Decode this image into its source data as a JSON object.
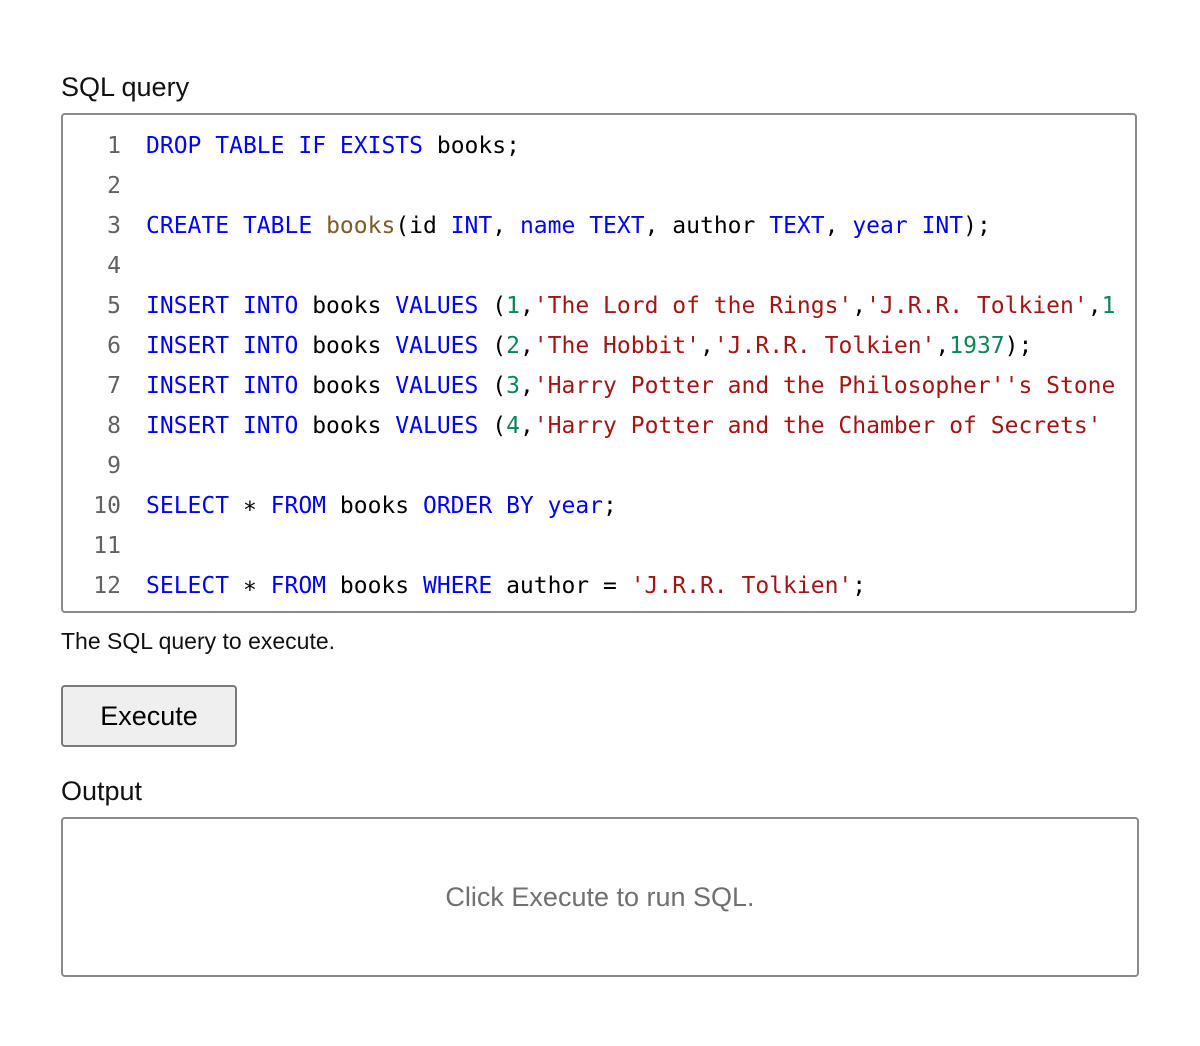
{
  "sql_query": {
    "label": "SQL query",
    "helper_text": "The SQL query to execute.",
    "line_numbers": [
      "1",
      "2",
      "3",
      "4",
      "5",
      "6",
      "7",
      "8",
      "9",
      "10",
      "11",
      "12"
    ],
    "lines": [
      [
        {
          "t": "DROP",
          "c": "kw"
        },
        {
          "t": " "
        },
        {
          "t": "TABLE",
          "c": "kw"
        },
        {
          "t": " "
        },
        {
          "t": "IF",
          "c": "kw"
        },
        {
          "t": " "
        },
        {
          "t": "EXISTS",
          "c": "kw"
        },
        {
          "t": " books;"
        }
      ],
      [],
      [
        {
          "t": "CREATE",
          "c": "kw"
        },
        {
          "t": " "
        },
        {
          "t": "TABLE",
          "c": "kw"
        },
        {
          "t": " "
        },
        {
          "t": "books",
          "c": "fn"
        },
        {
          "t": "(id "
        },
        {
          "t": "INT",
          "c": "kw"
        },
        {
          "t": ", "
        },
        {
          "t": "name",
          "c": "kw"
        },
        {
          "t": " "
        },
        {
          "t": "TEXT",
          "c": "kw"
        },
        {
          "t": ", author "
        },
        {
          "t": "TEXT",
          "c": "kw"
        },
        {
          "t": ", "
        },
        {
          "t": "year",
          "c": "kw"
        },
        {
          "t": " "
        },
        {
          "t": "INT",
          "c": "kw"
        },
        {
          "t": ");"
        }
      ],
      [],
      [
        {
          "t": "INSERT",
          "c": "kw"
        },
        {
          "t": " "
        },
        {
          "t": "INTO",
          "c": "kw"
        },
        {
          "t": " books "
        },
        {
          "t": "VALUES",
          "c": "kw"
        },
        {
          "t": " ("
        },
        {
          "t": "1",
          "c": "num"
        },
        {
          "t": ","
        },
        {
          "t": "'The Lord of the Rings'",
          "c": "str"
        },
        {
          "t": ","
        },
        {
          "t": "'J.R.R. Tolkien'",
          "c": "str"
        },
        {
          "t": ","
        },
        {
          "t": "1",
          "c": "num"
        }
      ],
      [
        {
          "t": "INSERT",
          "c": "kw"
        },
        {
          "t": " "
        },
        {
          "t": "INTO",
          "c": "kw"
        },
        {
          "t": " books "
        },
        {
          "t": "VALUES",
          "c": "kw"
        },
        {
          "t": " ("
        },
        {
          "t": "2",
          "c": "num"
        },
        {
          "t": ","
        },
        {
          "t": "'The Hobbit'",
          "c": "str"
        },
        {
          "t": ","
        },
        {
          "t": "'J.R.R. Tolkien'",
          "c": "str"
        },
        {
          "t": ","
        },
        {
          "t": "1937",
          "c": "num"
        },
        {
          "t": ");"
        }
      ],
      [
        {
          "t": "INSERT",
          "c": "kw"
        },
        {
          "t": " "
        },
        {
          "t": "INTO",
          "c": "kw"
        },
        {
          "t": " books "
        },
        {
          "t": "VALUES",
          "c": "kw"
        },
        {
          "t": " ("
        },
        {
          "t": "3",
          "c": "num"
        },
        {
          "t": ","
        },
        {
          "t": "'Harry Potter and the Philosopher''s Stone",
          "c": "str"
        }
      ],
      [
        {
          "t": "INSERT",
          "c": "kw"
        },
        {
          "t": " "
        },
        {
          "t": "INTO",
          "c": "kw"
        },
        {
          "t": " books "
        },
        {
          "t": "VALUES",
          "c": "kw"
        },
        {
          "t": " ("
        },
        {
          "t": "4",
          "c": "num"
        },
        {
          "t": ","
        },
        {
          "t": "'Harry Potter and the Chamber of Secrets'",
          "c": "str"
        }
      ],
      [],
      [
        {
          "t": "SELECT",
          "c": "kw"
        },
        {
          "t": " ∗ "
        },
        {
          "t": "FROM",
          "c": "kw"
        },
        {
          "t": " books "
        },
        {
          "t": "ORDER",
          "c": "kw"
        },
        {
          "t": " "
        },
        {
          "t": "BY",
          "c": "kw"
        },
        {
          "t": " "
        },
        {
          "t": "year",
          "c": "kw"
        },
        {
          "t": ";"
        }
      ],
      [],
      [
        {
          "t": "SELECT",
          "c": "kw"
        },
        {
          "t": " ∗ "
        },
        {
          "t": "FROM",
          "c": "kw"
        },
        {
          "t": " books "
        },
        {
          "t": "WHERE",
          "c": "kw"
        },
        {
          "t": " author = "
        },
        {
          "t": "'J.R.R. Tolkien'",
          "c": "str"
        },
        {
          "t": ";"
        }
      ]
    ]
  },
  "execute_button": {
    "label": "Execute"
  },
  "output": {
    "label": "Output",
    "placeholder": "Click Execute to run SQL."
  },
  "colors": {
    "keyword": "#0000ff",
    "function": "#795e26",
    "string": "#a31515",
    "number": "#098658",
    "line_number": "#616161"
  }
}
